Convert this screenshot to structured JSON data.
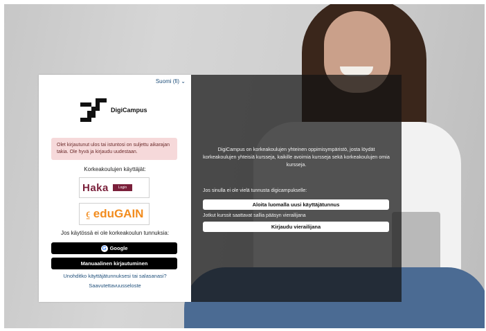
{
  "language_selector": {
    "label": "Suomi (fi) ⌄"
  },
  "logo": {
    "name": "DigiCampus"
  },
  "alert": {
    "text": "Olet kirjautunut ulos tai istuntosi on suljettu aikarajan takia. Ole hyvä ja kirjaudu uudestaan."
  },
  "login": {
    "institution_users_label": "Korkeakoulujen käyttäjät:",
    "haka": {
      "word": "Haka",
      "button": "Login"
    },
    "edugain": {
      "word": "eduGAIN"
    },
    "no_account_label": "Jos käytössä ei ole korkeakoulun tunnuksia:",
    "google_button": "Google",
    "manual_button": "Manuaalinen kirjautuminen",
    "forgot_link": "Unohditko käyttäjätunnuksesi tai salasanasi?",
    "accessibility_link": "Saavutettavuusseloste"
  },
  "info": {
    "description": "DigiCampus on korkeakoulujen yhteinen oppimisympäristö, josta löydät korkeakoulujen yhteisiä kursseja, kaikille avoimia kursseja sekä korkeakoulujen omia kursseja.",
    "no_account_text": "Jos sinulla ei ole vielä tunnusta digicampukselle:",
    "create_account_button": "Aloita luomalla uusi käyttäjätunnus",
    "guest_text": "Jotkut kurssit saattavat sallia pääsyn vierailijana",
    "guest_button": "Kirjaudu vierailijana"
  },
  "colors": {
    "accent_link": "#1f4f7a",
    "alert_bg": "#f6d9da",
    "haka": "#7a1f3a",
    "edugain": "#f28c1e"
  }
}
